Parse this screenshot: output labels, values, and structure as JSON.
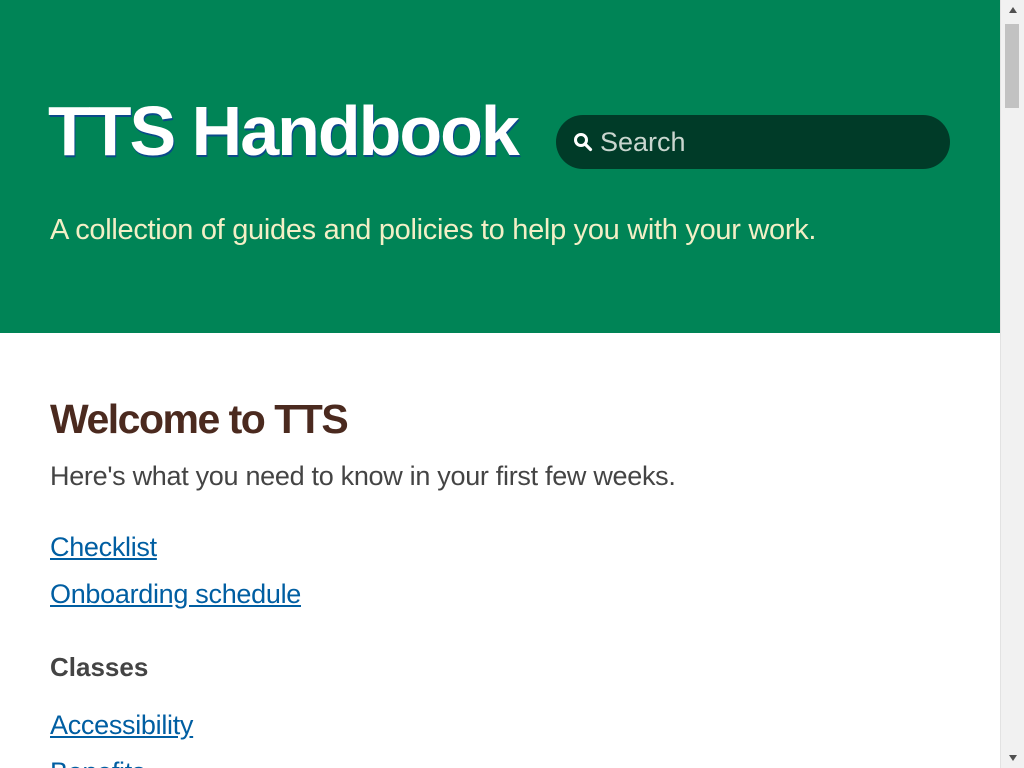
{
  "header": {
    "title": "TTS Handbook",
    "tagline": "A collection of guides and policies to help you with your work.",
    "search": {
      "placeholder": "Search",
      "value": "",
      "icon": "search-icon"
    }
  },
  "main": {
    "heading": "Welcome to TTS",
    "intro": "Here's what you need to know in your first few weeks.",
    "links": [
      {
        "label": "Checklist"
      },
      {
        "label": "Onboarding schedule"
      }
    ],
    "classes": {
      "heading": "Classes",
      "links": [
        {
          "label": "Accessibility"
        },
        {
          "label": "Benefits"
        }
      ]
    }
  },
  "scrollbar": {
    "icons": [
      "chevron-up-icon",
      "chevron-down-icon"
    ]
  },
  "colors": {
    "hero_background": "#008456",
    "search_background": "#003b28",
    "tagline": "#f3efc6",
    "heading": "#4b2a1f",
    "link": "#005ea2"
  }
}
